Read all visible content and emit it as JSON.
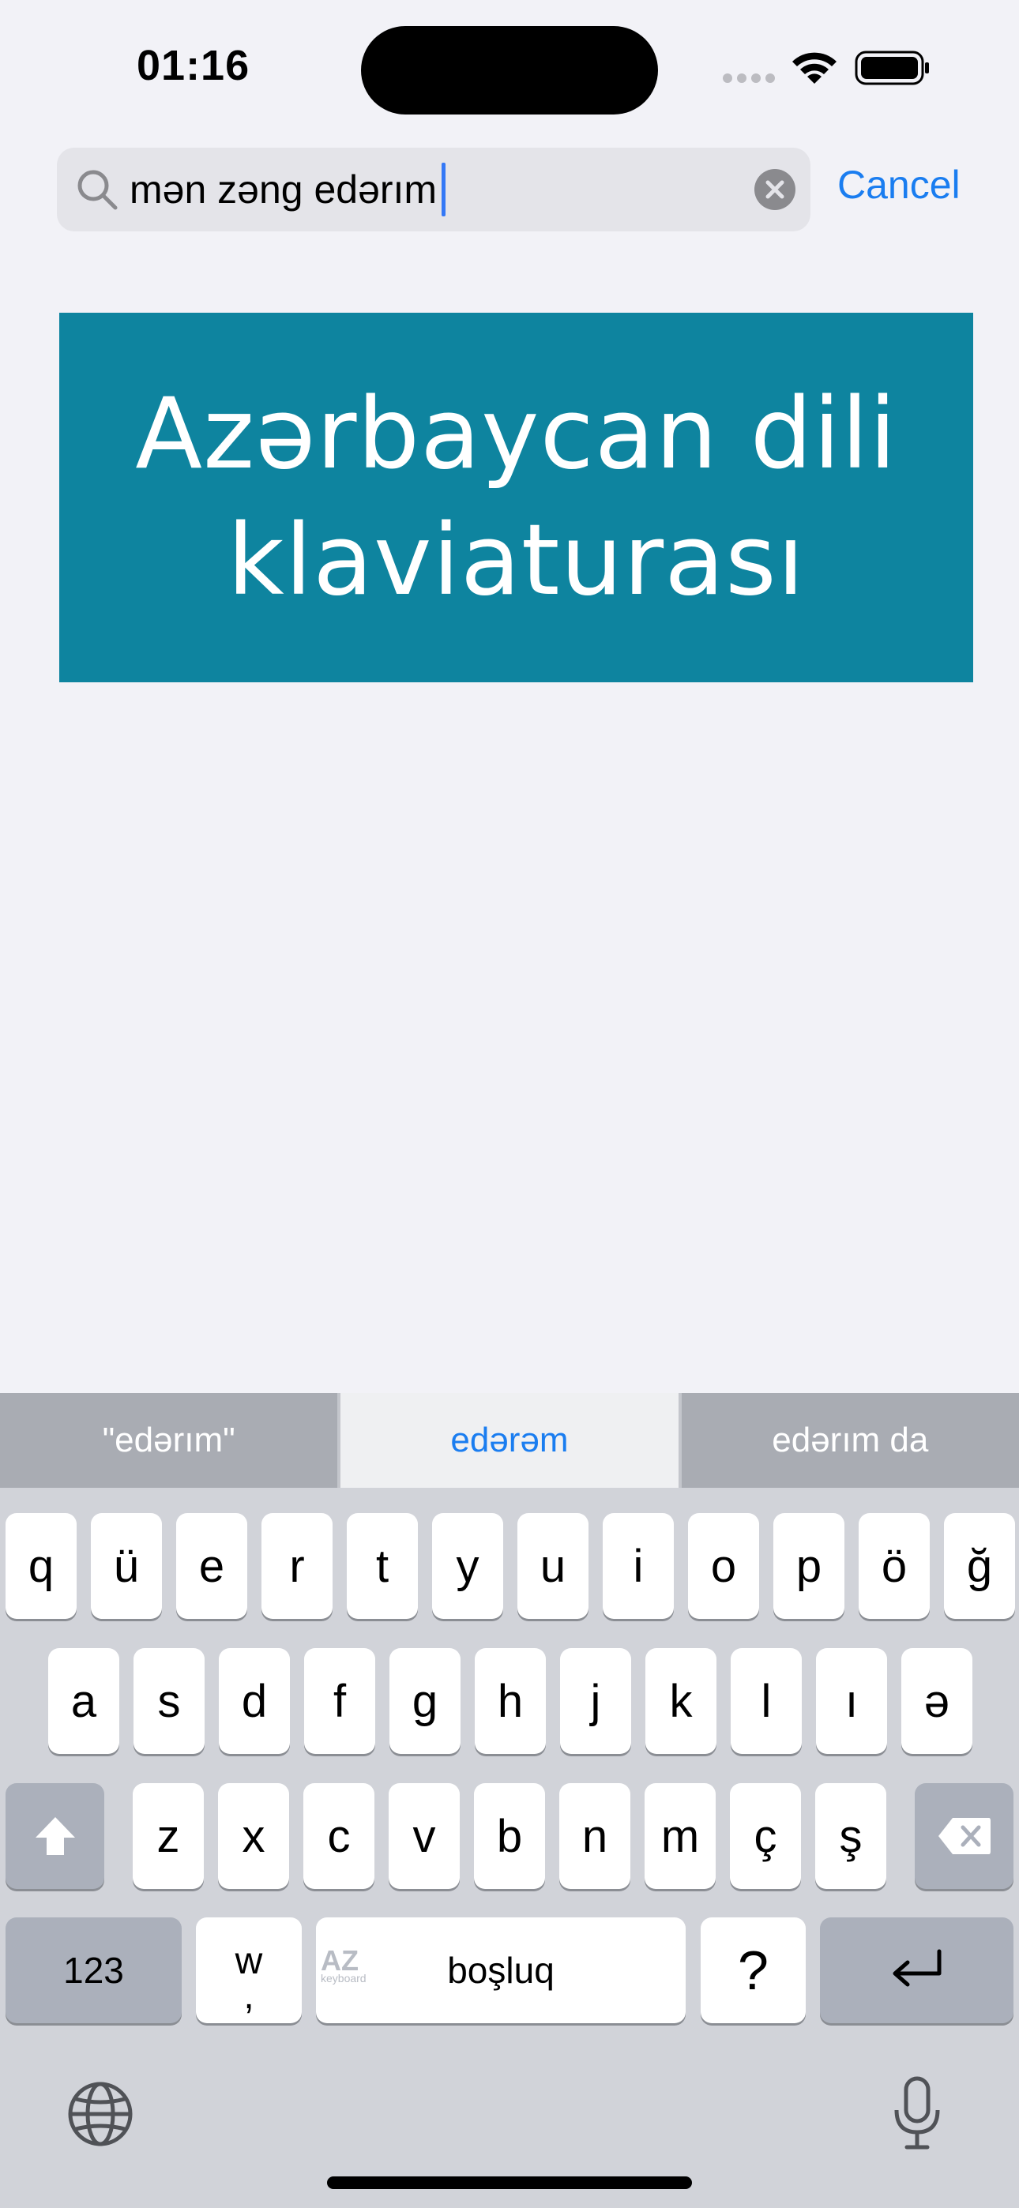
{
  "status_bar": {
    "time": "01:16"
  },
  "search": {
    "value": "mən zəng edərım",
    "cancel_label": "Cancel"
  },
  "banner": {
    "line1": "Azərbaycan dili",
    "line2": "klaviaturası"
  },
  "keyboard": {
    "suggestions": [
      "\"edərım\"",
      "edərəm",
      "edərım da"
    ],
    "row1": [
      "q",
      "ü",
      "e",
      "r",
      "t",
      "y",
      "u",
      "i",
      "o",
      "p",
      "ö",
      "ğ"
    ],
    "row2": [
      "a",
      "s",
      "d",
      "f",
      "g",
      "h",
      "j",
      "k",
      "l",
      "ı",
      "ə"
    ],
    "row3": [
      "z",
      "x",
      "c",
      "v",
      "b",
      "n",
      "m",
      "ç",
      "ş"
    ],
    "numbers_label": "123",
    "w_key": {
      "main": "w",
      "sub": ","
    },
    "space_label": "boşluq",
    "space_logo": "AZ",
    "space_logo_sub": "keyboard",
    "question_label": "?"
  }
}
